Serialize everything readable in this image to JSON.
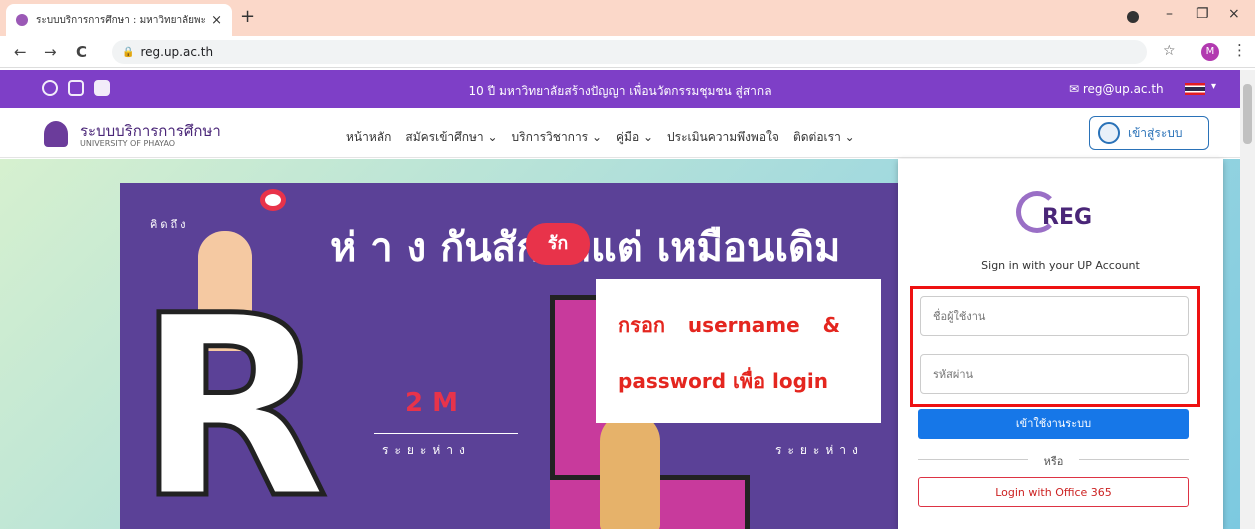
{
  "browser": {
    "tab_title": "ระบบบริการการศึกษา : มหาวิทยาลัยพะ",
    "tab_close": "×",
    "new_tab": "+",
    "url": "reg.up.ac.th",
    "profile_letter": "M",
    "back": "←",
    "forward": "→",
    "reload": "C",
    "star": "☆",
    "menu": "⋮",
    "minimize": "–",
    "restore": "❐",
    "close": "×"
  },
  "topbar": {
    "message": "10 ปี มหาวิทยาลัยสร้างปัญญา เพื่อนวัตกรรมชุมชน สู่สากล",
    "email": "reg@up.ac.th"
  },
  "header": {
    "brand_title": "ระบบบริการการศึกษา",
    "brand_subtitle": "UNIVERSITY OF PHAYAO",
    "menu": [
      "หน้าหลัก",
      "สมัครเข้าศึกษา ⌄",
      "บริการวิชาการ ⌄",
      "คู่มือ ⌄",
      "ประเมินความพึงพอใจ",
      "ติดต่อเรา ⌄"
    ],
    "login_label": "เข้าสู่ระบบ"
  },
  "banner": {
    "title": "ห่ า ง กันสักพักแต่      เหมือนเดิม",
    "rak": "รัก",
    "kidthung": "คิดถึง",
    "two_m": "2 M",
    "distance": "ระยะห่าง",
    "big_letter": "R"
  },
  "callout": {
    "line1": "กรอก username &",
    "line2": "password เพื่อ login"
  },
  "login_panel": {
    "logo_text": "REG",
    "signin_text": "Sign in with your UP Account",
    "username_placeholder": "ชื่อผู้ใช้งาน",
    "password_placeholder": "รหัสผ่าน",
    "submit_label": "เข้าใช้งานระบบ",
    "or_label": "หรือ",
    "office_label": "Login with Office 365"
  }
}
